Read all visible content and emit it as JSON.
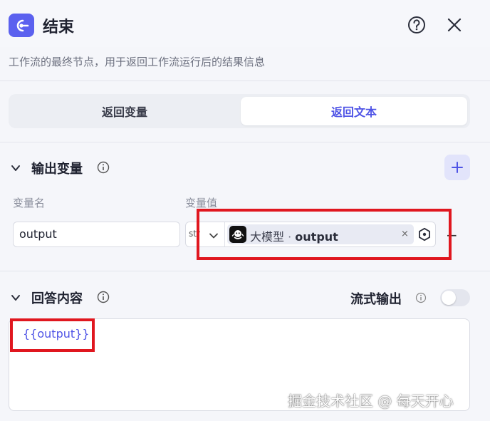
{
  "header": {
    "title": "结束",
    "node_icon": "end-node-icon",
    "help_icon": "question-icon",
    "close_icon": "close-icon",
    "description": "工作流的最终节点，用于返回工作流运行后的结果信息"
  },
  "tabs": [
    {
      "label": "返回变量",
      "selected": false
    },
    {
      "label": "返回文本",
      "selected": true
    }
  ],
  "output_section": {
    "title": "输出变量",
    "add_icon": "plus-icon",
    "name_column": "变量名",
    "value_column": "变量值",
    "variable": {
      "name": "output",
      "type": "str.",
      "source": "大模型",
      "separator": " · ",
      "field": "output",
      "clear": "×"
    },
    "remove": "−"
  },
  "answer_section": {
    "title": "回答内容",
    "stream_label": "流式输出",
    "stream_enabled": false,
    "content": "{{output}}"
  },
  "watermark": "掘金技术社区 @ 每天开心",
  "colors": {
    "accent": "#4f54e6",
    "node_icon_bg": "#5b61ef",
    "highlight_red": "#e0171f"
  }
}
